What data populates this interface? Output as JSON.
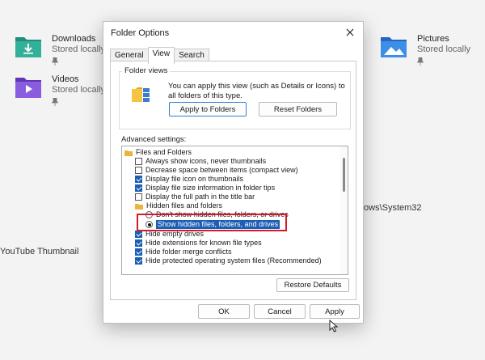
{
  "background": {
    "items": [
      {
        "name": "Downloads",
        "sub": "Stored locally",
        "icon": "downloads-folder-icon",
        "color": "#2e9b8a"
      },
      {
        "name": "Videos",
        "sub": "Stored locally",
        "icon": "videos-folder-icon",
        "color": "#7b4fd6"
      },
      {
        "name": "Pictures",
        "sub": "Stored locally",
        "icon": "pictures-folder-icon",
        "color": "#2f7fd8"
      }
    ],
    "path_fragment": "ows\\System32",
    "thumbnail_text": "YouTube Thumbnail"
  },
  "dialog": {
    "title": "Folder Options",
    "close_icon": "close-icon",
    "tabs": [
      {
        "label": "General",
        "active": false
      },
      {
        "label": "View",
        "active": true
      },
      {
        "label": "Search",
        "active": false
      }
    ],
    "folder_views": {
      "label": "Folder views",
      "description": "You can apply this view (such as Details or Icons) to all folders of this type.",
      "apply_button": "Apply to Folders",
      "reset_button": "Reset Folders"
    },
    "advanced": {
      "label": "Advanced settings:",
      "items": [
        {
          "type": "folder",
          "label": "Files and Folders"
        },
        {
          "type": "checkbox",
          "checked": false,
          "label": "Always show icons, never thumbnails"
        },
        {
          "type": "checkbox",
          "checked": false,
          "label": "Decrease space between items (compact view)"
        },
        {
          "type": "checkbox",
          "checked": true,
          "label": "Display file icon on thumbnails"
        },
        {
          "type": "checkbox",
          "checked": true,
          "label": "Display file size information in folder tips"
        },
        {
          "type": "checkbox",
          "checked": false,
          "label": "Display the full path in the title bar"
        },
        {
          "type": "folder",
          "label": "Hidden files and folders"
        },
        {
          "type": "radio",
          "selected": false,
          "label": "Don't show hidden files, folders, or drives"
        },
        {
          "type": "radio",
          "selected": true,
          "label": "Show hidden files, folders, and drives",
          "highlighted": true
        },
        {
          "type": "checkbox",
          "checked": true,
          "label": "Hide empty drives"
        },
        {
          "type": "checkbox",
          "checked": true,
          "label": "Hide extensions for known file types"
        },
        {
          "type": "checkbox",
          "checked": true,
          "label": "Hide folder merge conflicts"
        },
        {
          "type": "checkbox",
          "checked": true,
          "label": "Hide protected operating system files (Recommended)"
        }
      ],
      "restore_button": "Restore Defaults"
    },
    "footer": {
      "ok": "OK",
      "cancel": "Cancel",
      "apply": "Apply"
    },
    "accent_color": "#1a5fb4",
    "highlight_border_color": "#d01b2a"
  }
}
